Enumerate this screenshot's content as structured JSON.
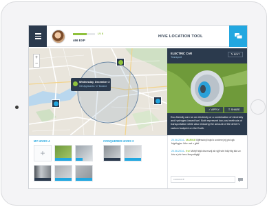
{
  "header": {
    "level": "LV 6",
    "level_progress": 0.62,
    "xp": "466 EXP",
    "title": "HIVE LOCATION TOOL"
  },
  "map": {
    "zoom_in": "+",
    "zoom_out": "−",
    "callout_title": "Wednesday, December 3",
    "callout_sub": "150 Applicants  /  17 Booked"
  },
  "hives": {
    "my_label": "MY HIVES",
    "my_count": "4",
    "add_label": "+",
    "conquered_label": "CONQUERED HIVES",
    "conquered_count": "2"
  },
  "panel": {
    "title": "ELECTRIC CAR",
    "subtitle": "Transport",
    "edit": "EDIT",
    "apply": "APPLY",
    "share": "SHARE",
    "description": "Eco-friendly car run on electricity or a combination of electricity and hydrogen-based fuel. Both represent low-cost methods of transportation while also reducing the amount of the driver's carbon footprint on the Earth."
  },
  "comments": [
    {
      "date": "20.06.2014",
      "user": "MARIKE",
      "text": "Bjffnwdvjl hqtd k sxxbmrj ejj ptd qjk fdgbhgjav. Ikkv uwl x jyktf"
    },
    {
      "date": "20.06.2014",
      "user": "frzr",
      "text": "Mkhjf hbjd dwvrvvdj ab sjjfi wht hdjvhtg iskt zv. kkv z jxfv hrxu ihwyutdgkjl"
    }
  ],
  "comment_placeholder": "comment",
  "colors": {
    "navy": "#2b3a4d",
    "blue": "#22a7e0",
    "green": "#8fc13c"
  }
}
